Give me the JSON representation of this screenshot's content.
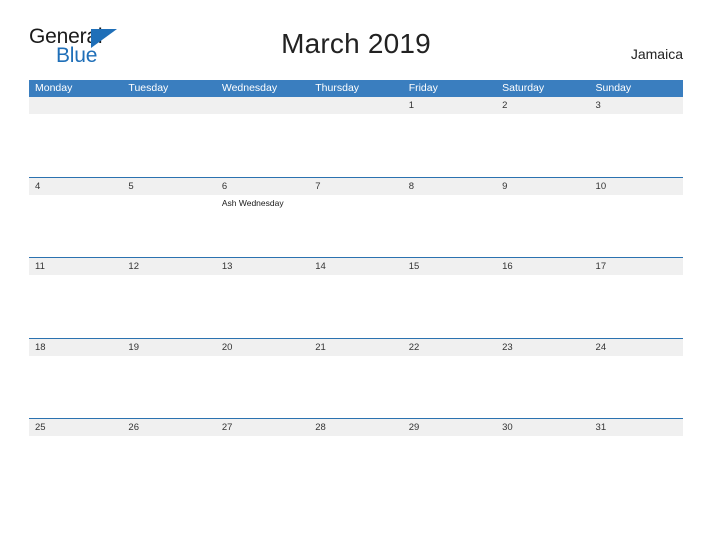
{
  "brand": {
    "name_part1": "General",
    "name_part2": "Blue",
    "triangle_color": "#1f6fb8"
  },
  "header": {
    "title": "March 2019",
    "locale": "Jamaica"
  },
  "theme": {
    "header_blue": "#3a7ebf",
    "row_border_blue": "#2b72b0",
    "day_band_gray": "#f0f0f0"
  },
  "calendar": {
    "weekdays": [
      "Monday",
      "Tuesday",
      "Wednesday",
      "Thursday",
      "Friday",
      "Saturday",
      "Sunday"
    ],
    "weeks": [
      [
        {
          "day": "",
          "events": []
        },
        {
          "day": "",
          "events": []
        },
        {
          "day": "",
          "events": []
        },
        {
          "day": "",
          "events": []
        },
        {
          "day": "1",
          "events": []
        },
        {
          "day": "2",
          "events": []
        },
        {
          "day": "3",
          "events": []
        }
      ],
      [
        {
          "day": "4",
          "events": []
        },
        {
          "day": "5",
          "events": []
        },
        {
          "day": "6",
          "events": [
            "Ash Wednesday"
          ]
        },
        {
          "day": "7",
          "events": []
        },
        {
          "day": "8",
          "events": []
        },
        {
          "day": "9",
          "events": []
        },
        {
          "day": "10",
          "events": []
        }
      ],
      [
        {
          "day": "11",
          "events": []
        },
        {
          "day": "12",
          "events": []
        },
        {
          "day": "13",
          "events": []
        },
        {
          "day": "14",
          "events": []
        },
        {
          "day": "15",
          "events": []
        },
        {
          "day": "16",
          "events": []
        },
        {
          "day": "17",
          "events": []
        }
      ],
      [
        {
          "day": "18",
          "events": []
        },
        {
          "day": "19",
          "events": []
        },
        {
          "day": "20",
          "events": []
        },
        {
          "day": "21",
          "events": []
        },
        {
          "day": "22",
          "events": []
        },
        {
          "day": "23",
          "events": []
        },
        {
          "day": "24",
          "events": []
        }
      ],
      [
        {
          "day": "25",
          "events": []
        },
        {
          "day": "26",
          "events": []
        },
        {
          "day": "27",
          "events": []
        },
        {
          "day": "28",
          "events": []
        },
        {
          "day": "29",
          "events": []
        },
        {
          "day": "30",
          "events": []
        },
        {
          "day": "31",
          "events": []
        }
      ]
    ]
  }
}
